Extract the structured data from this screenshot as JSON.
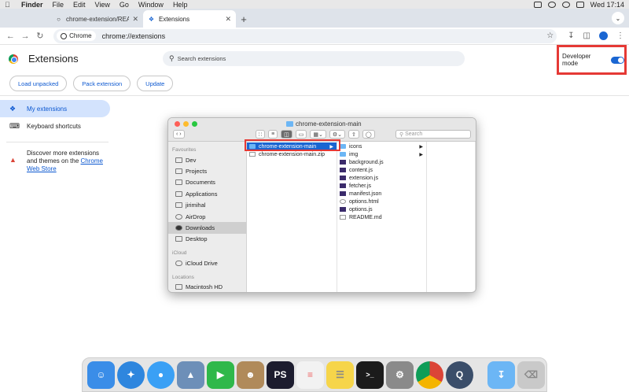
{
  "menubar": {
    "app": "Finder",
    "items": [
      "File",
      "Edit",
      "View",
      "Go",
      "Window",
      "Help"
    ],
    "clock": "Wed 17:14"
  },
  "tabs": [
    {
      "title": "chrome-extension/README.m",
      "active": false
    },
    {
      "title": "Extensions",
      "active": true
    }
  ],
  "toolbar": {
    "chip_label": "Chrome",
    "url": "chrome://extensions"
  },
  "header": {
    "title": "Extensions",
    "search_placeholder": "Search extensions",
    "dev_mode_label": "Developer mode",
    "dev_mode_on": true
  },
  "actions": {
    "load_unpacked": "Load unpacked",
    "pack_extension": "Pack extension",
    "update": "Update"
  },
  "sidebar": {
    "my_extensions": "My extensions",
    "keyboard_shortcuts": "Keyboard shortcuts",
    "discover_text": "Discover more extensions and themes on the",
    "discover_link": "Chrome Web Store"
  },
  "finder": {
    "title": "chrome-extension-main",
    "search_placeholder": "Search",
    "favourites_label": "Favourites",
    "favourites": [
      "Dev",
      "Projects",
      "Documents",
      "Applications",
      "jirimihal",
      "AirDrop",
      "Downloads",
      "Desktop"
    ],
    "icloud_label": "iCloud",
    "icloud": [
      "iCloud Drive"
    ],
    "locations_label": "Locations",
    "locations": [
      "Macintosh HD"
    ],
    "col1": [
      {
        "name": "chrome-extension-main",
        "kind": "folder",
        "selected": true,
        "arrow": true
      },
      {
        "name": "chrome-extension-main.zip",
        "kind": "doc",
        "selected": false,
        "arrow": false
      }
    ],
    "col2": [
      {
        "name": "icons",
        "kind": "folder",
        "arrow": true
      },
      {
        "name": "img",
        "kind": "folder",
        "arrow": true
      },
      {
        "name": "background.js",
        "kind": "js",
        "arrow": false
      },
      {
        "name": "content.js",
        "kind": "js",
        "arrow": false
      },
      {
        "name": "extension.js",
        "kind": "js",
        "arrow": false
      },
      {
        "name": "fetcher.js",
        "kind": "js",
        "arrow": false
      },
      {
        "name": "manifest.json",
        "kind": "js",
        "arrow": false
      },
      {
        "name": "options.html",
        "kind": "doc",
        "arrow": false
      },
      {
        "name": "options.js",
        "kind": "js",
        "arrow": false
      },
      {
        "name": "README.md",
        "kind": "doc",
        "arrow": false
      }
    ]
  },
  "dock": [
    {
      "name": "finder",
      "color": "#3a8de8"
    },
    {
      "name": "safari",
      "color": "#2e86de"
    },
    {
      "name": "messages",
      "color": "#3aa0f5"
    },
    {
      "name": "preview",
      "color": "#6d8fb8"
    },
    {
      "name": "facetime",
      "color": "#2fb84a"
    },
    {
      "name": "contacts",
      "color": "#b08a5a"
    },
    {
      "name": "phpstorm",
      "color": "#1c1c2e",
      "label": "PS"
    },
    {
      "name": "reminders",
      "color": "#f2f2f2"
    },
    {
      "name": "notes",
      "color": "#f6d54a"
    },
    {
      "name": "terminal",
      "color": "#1b1b1b"
    },
    {
      "name": "system-preferences",
      "color": "#8a8a8a"
    },
    {
      "name": "chrome",
      "color": "#e5e5e5"
    },
    {
      "name": "quicktime",
      "color": "#3b4e6a"
    },
    {
      "name": "downloads",
      "color": "#6cb6f5"
    },
    {
      "name": "trash",
      "color": "#c9c9c9"
    }
  ]
}
